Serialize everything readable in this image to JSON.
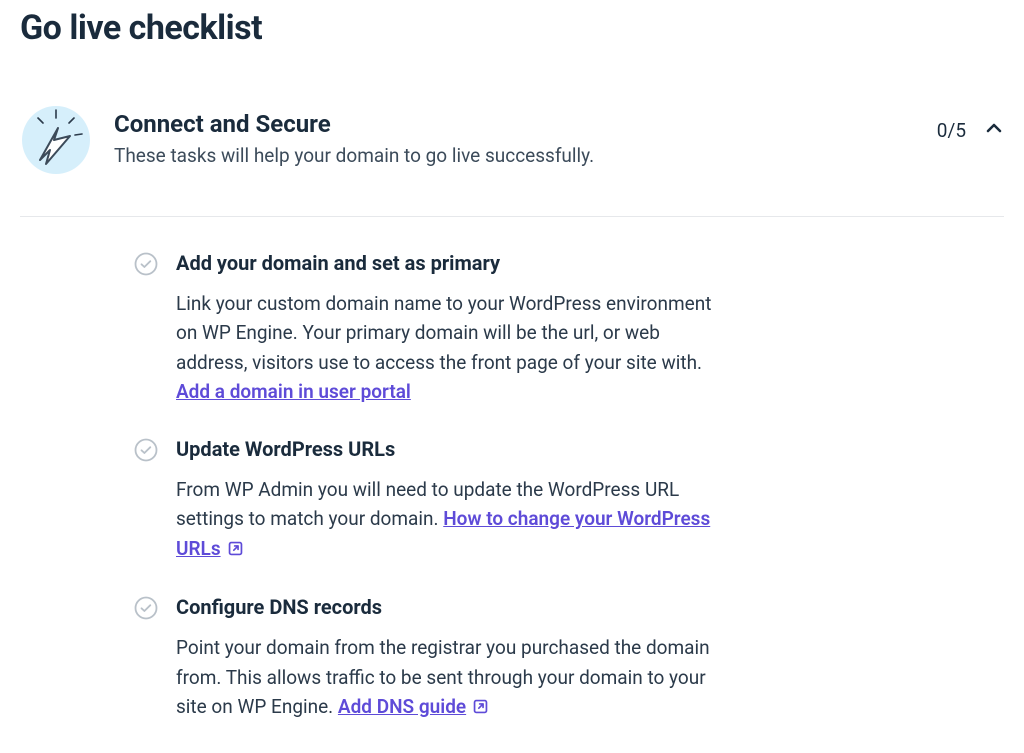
{
  "page": {
    "title": "Go live checklist"
  },
  "section": {
    "title": "Connect and Secure",
    "subtitle": "These tasks will help your domain to go live successfully.",
    "completed": 0,
    "total": 5,
    "progress_label": "0/5"
  },
  "tasks": [
    {
      "title": "Add your domain and set as primary",
      "body_prefix": "Link your custom domain name to your WordPress environment on WP Engine. Your primary domain will be the url, or web address, visitors use to access the front page of your site with. ",
      "link_text": "Add a domain in user portal",
      "external": false
    },
    {
      "title": "Update WordPress URLs",
      "body_prefix": "From WP Admin you will need to update the WordPress URL settings to match your domain.  ",
      "link_text": "How to change your WordPress URLs",
      "external": true
    },
    {
      "title": "Configure DNS records",
      "body_prefix": "Point your domain from the registrar you purchased the domain from. This allows traffic to be sent through your domain to your site on WP Engine.  ",
      "link_text": "Add DNS guide",
      "external": true
    }
  ]
}
